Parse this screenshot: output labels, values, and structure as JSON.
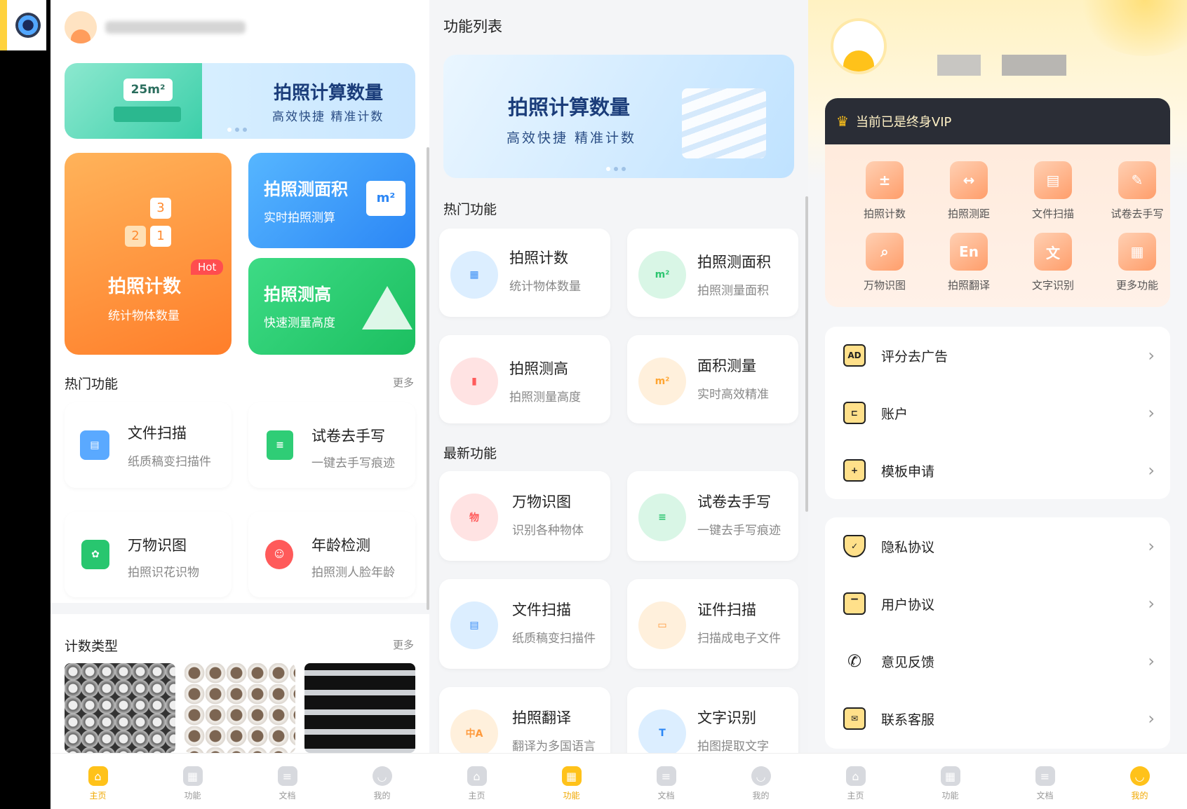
{
  "screen1": {
    "banner": {
      "title": "拍照计算数量",
      "subtitle": "高效快捷 精准计数",
      "area_badge": "25m²"
    },
    "big_cards": [
      {
        "title": "拍照计数",
        "subtitle": "统计物体数量",
        "badge": "Hot"
      },
      {
        "title": "拍照测面积",
        "subtitle": "实时拍照测算"
      },
      {
        "title": "拍照测高",
        "subtitle": "快速测量高度"
      }
    ],
    "hot_title": "热门功能",
    "hot_more": "更多",
    "hot_items": [
      {
        "title": "文件扫描",
        "subtitle": "纸质稿变扫描件"
      },
      {
        "title": "试卷去手写",
        "subtitle": "一键去手写痕迹"
      },
      {
        "title": "万物识图",
        "subtitle": "拍照识花识物"
      },
      {
        "title": "年龄检测",
        "subtitle": "拍照测人脸年龄"
      }
    ],
    "count_title": "计数类型",
    "count_more": "更多"
  },
  "screen2": {
    "page_title": "功能列表",
    "banner": {
      "title": "拍照计算数量",
      "subtitle": "高效快捷 精准计数"
    },
    "hot_title": "热门功能",
    "hot_items": [
      {
        "title": "拍照计数",
        "subtitle": "统计物体数量"
      },
      {
        "title": "拍照测面积",
        "subtitle": "拍照测量面积"
      },
      {
        "title": "拍照测高",
        "subtitle": "拍照测量高度"
      },
      {
        "title": "面积测量",
        "subtitle": "实时高效精准"
      }
    ],
    "new_title": "最新功能",
    "new_items": [
      {
        "title": "万物识图",
        "subtitle": "识别各种物体"
      },
      {
        "title": "试卷去手写",
        "subtitle": "一键去手写痕迹"
      },
      {
        "title": "文件扫描",
        "subtitle": "纸质稿变扫描件"
      },
      {
        "title": "证件扫描",
        "subtitle": "扫描成电子文件"
      },
      {
        "title": "拍照翻译",
        "subtitle": "翻译为多国语言"
      },
      {
        "title": "文字识别",
        "subtitle": "拍图提取文字"
      }
    ]
  },
  "screen3": {
    "vip_text": "当前已是终身VIP",
    "functions": [
      "拍照计数",
      "拍照测距",
      "文件扫描",
      "试卷去手写",
      "万物识图",
      "拍照翻译",
      "文字识别",
      "更多功能"
    ],
    "menu_group1": [
      {
        "label": "评分去广告",
        "icon": "AD"
      },
      {
        "label": "账户",
        "icon": "wallet-icon"
      },
      {
        "label": "模板申请",
        "icon": "file-plus-icon"
      }
    ],
    "menu_group2": [
      {
        "label": "隐私协议",
        "icon": "shield-icon"
      },
      {
        "label": "用户协议",
        "icon": "bookmark-icon"
      },
      {
        "label": "意见反馈",
        "icon": "phone-icon"
      },
      {
        "label": "联系客服",
        "icon": "mail-icon"
      }
    ]
  },
  "tabs": [
    "主页",
    "功能",
    "文档",
    "我的"
  ],
  "colors": {
    "accent": "#ffc21a",
    "orange": "#ff9a3c",
    "blue": "#3aa0ff",
    "green": "#2ccf72",
    "dark": "#2a2d36"
  }
}
